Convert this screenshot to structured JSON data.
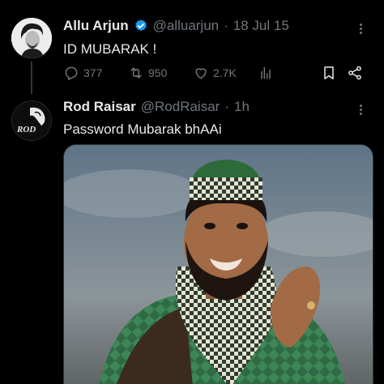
{
  "tweet1": {
    "name": "Allu Arjun",
    "handle": "@alluarjun",
    "separator": "·",
    "date": "18 Jul 15",
    "text": "ID MUBARAK !",
    "actions": {
      "replies": "377",
      "retweets": "950",
      "likes": "2.7K"
    }
  },
  "tweet2": {
    "name": "Rod Raisar",
    "handle": "@RodRaisar",
    "separator": "·",
    "time": "1h",
    "text": "Password Mubarak bhAAi",
    "avatar_text": "ROD"
  },
  "icons": {
    "verified": "verified-badge-icon",
    "reply": "reply-icon",
    "retweet": "retweet-icon",
    "like": "heart-icon",
    "views": "views-chart-icon",
    "bookmark": "bookmark-icon",
    "share": "share-icon",
    "more": "more-dots-icon"
  },
  "colors": {
    "background": "#000000",
    "text": "#e7e9ea",
    "muted": "#71767b",
    "verified": "#1d9bf0"
  }
}
